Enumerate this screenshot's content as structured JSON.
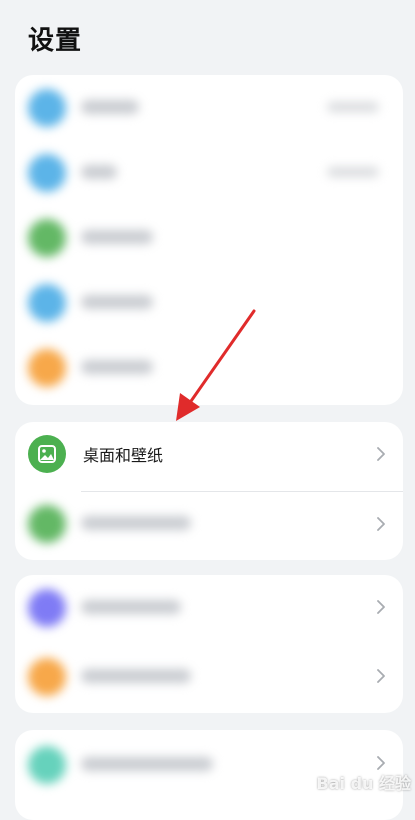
{
  "header": {
    "title": "设置"
  },
  "wallpaper_item": {
    "label": "桌面和壁纸"
  },
  "watermark": {
    "text": "Bai du 经验"
  },
  "colors": {
    "blue": "#5cb4e8",
    "green": "#63b865",
    "orange": "#f7a84a",
    "purple": "#7f7bf5",
    "teal": "#66d2bc",
    "wallpaper_icon_bg": "#4cb050",
    "arrow": "#e02b2b"
  }
}
